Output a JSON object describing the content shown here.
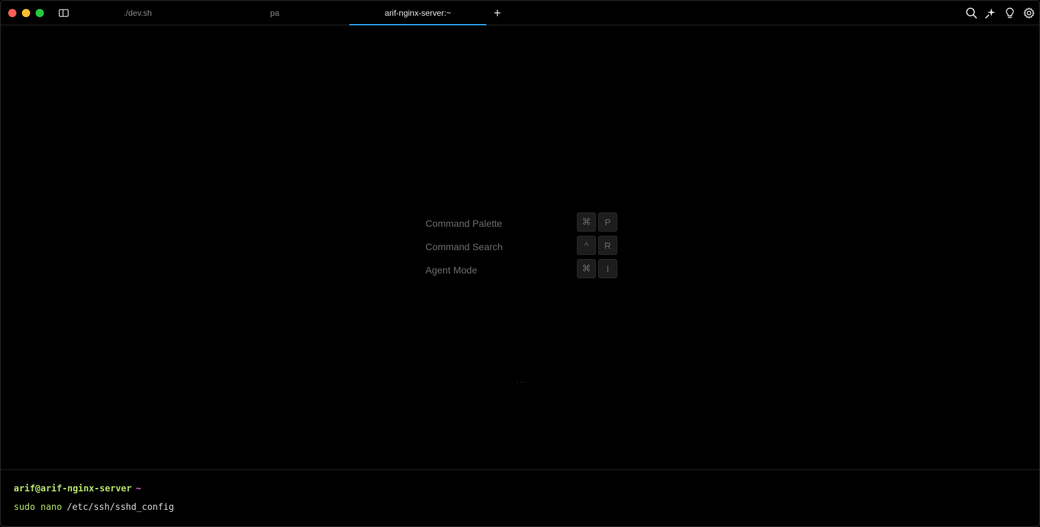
{
  "tabs": [
    {
      "label": "./dev.sh",
      "active": false
    },
    {
      "label": "pa",
      "active": false
    },
    {
      "label": "arif-nginx-server:~",
      "active": true
    }
  ],
  "new_tab_label": "+",
  "toolbar_icons": [
    "search-icon",
    "ai-sparkle-icon",
    "lightbulb-icon",
    "gear-icon"
  ],
  "hints": [
    {
      "label": "Command Palette",
      "keys": [
        "⌘",
        "P"
      ]
    },
    {
      "label": "Command Search",
      "keys": [
        "^",
        "R"
      ]
    },
    {
      "label": "Agent Mode",
      "keys": [
        "⌘",
        "I"
      ]
    }
  ],
  "ellipsis": "···",
  "prompt": {
    "user_host": "arif@arif-nginx-server",
    "cwd": "~"
  },
  "input": {
    "executable": "sudo nano",
    "args": "/etc/ssh/sshd_config"
  },
  "colors": {
    "accent_tab": "#2b9fe0",
    "prompt_green": "#b5e26b",
    "prompt_magenta": "#d66bd6"
  }
}
